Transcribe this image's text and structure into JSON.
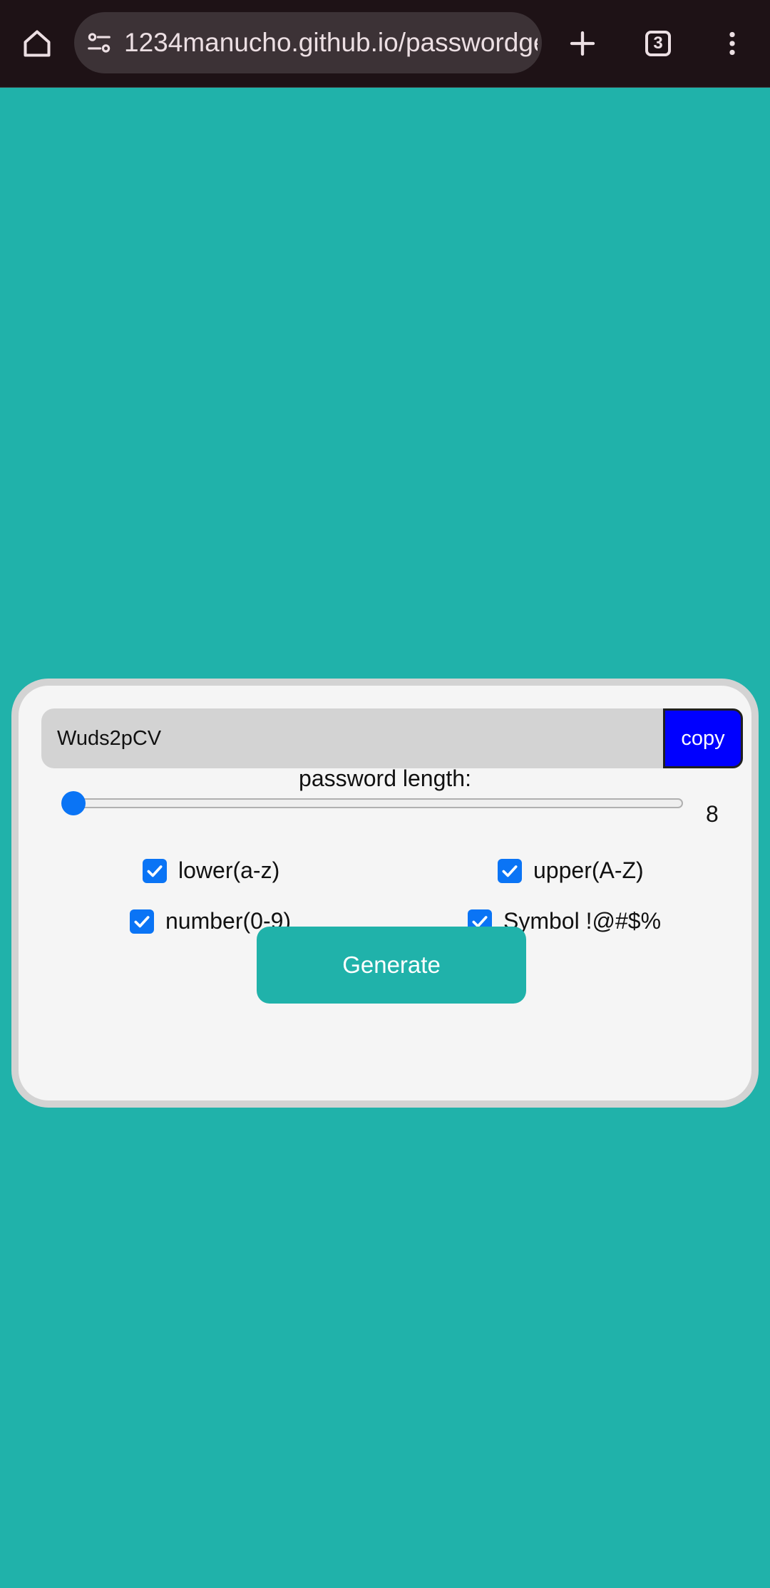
{
  "browser": {
    "url": "1234manucho.github.io/passwordge",
    "tab_count": "3",
    "icons": [
      "home-icon",
      "site-info-icon",
      "plus-icon",
      "tab-switcher-icon",
      "more-vert-icon"
    ]
  },
  "app": {
    "password_value": "Wuds2pCV",
    "copy_label": "copy",
    "length_label": "password length:",
    "length_value": "8",
    "slider_level": 0,
    "options": {
      "lower": {
        "label": "lower(a-z)",
        "checked": true
      },
      "upper": {
        "label": "upper(A-Z)",
        "checked": true
      },
      "number": {
        "label": "number(0-9)",
        "checked": true
      },
      "symbol": {
        "label": "Symbol !@#$%",
        "checked": true
      }
    },
    "generate_label": "Generate"
  },
  "colors": {
    "page_background": "#20b2aa",
    "card_background": "#f5f5f5",
    "card_border": "#d3d3d3",
    "copy_button": "#0000ff",
    "generate_button": "#20b2aa",
    "checkbox_accent": "#0a74f5",
    "browser_bar": "#1e1216"
  }
}
